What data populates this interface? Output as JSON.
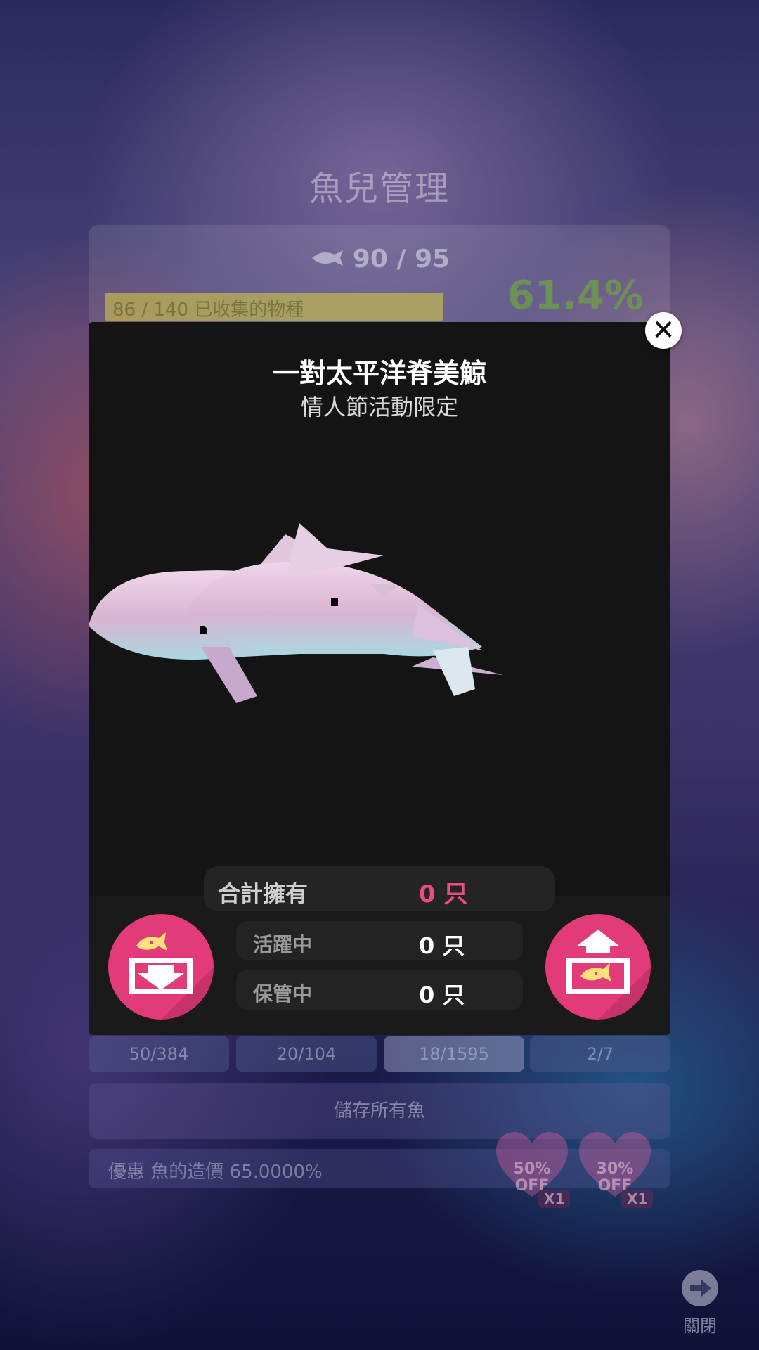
{
  "background": {
    "title": "魚兒管理",
    "fish_count": "90 / 95",
    "progress_text": "86 / 140 已收集的物種",
    "progress_fraction": 0.614,
    "percent": "61.4%",
    "tabs": [
      {
        "label": "50/384",
        "active": false
      },
      {
        "label": "20/104",
        "active": false
      },
      {
        "label": "18/1595",
        "active": true
      },
      {
        "label": "2/7",
        "active": false
      }
    ],
    "save_all": "儲存所有魚",
    "discount_text": "優惠 魚的造價 65.0000%",
    "coupons": [
      {
        "label": "50%",
        "label2": "OFF",
        "qty": "X1"
      },
      {
        "label": "30%",
        "label2": "OFF",
        "qty": "X1"
      }
    ],
    "exit_label": "關閉"
  },
  "dialog": {
    "fish_name": "一對太平洋脊美鯨",
    "fish_subtitle": "情人節活動限定",
    "total_label": "合計擁有",
    "total_value": "0 只",
    "active_label": "活躍中",
    "active_value": "0 只",
    "stored_label": "保管中",
    "stored_value": "0 只"
  },
  "colors": {
    "accent_pink": "#e33a79",
    "total_value": "#e84d7f",
    "dialog_bg": "#141414"
  },
  "icons": {
    "close": "close-icon",
    "store": "store-fish-icon",
    "release": "release-fish-icon",
    "exit": "exit-arrow-icon"
  }
}
